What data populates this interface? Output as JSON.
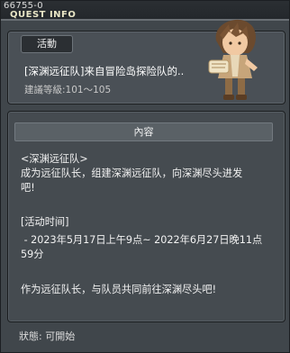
{
  "window": {
    "id": "66755-0",
    "title": "QUEST INFO"
  },
  "quest": {
    "badge": "活動",
    "name": "[深渊远征队]来自冒险岛探险队的..",
    "level": "建議等級:101～105"
  },
  "content": {
    "header": "內容",
    "lines": [
      "<深渊远征队>",
      "成为远征队长，组建深渊远征队，向深渊尽头进发",
      "吧!",
      "",
      "[活动时间]",
      " - 2023年5月17日上午9点~ 2022年6月27日晚11点",
      "59分",
      "",
      "作为远征队长，与队员共同前往深渊尽头吧!"
    ]
  },
  "status": {
    "text": "狀態: 可開始"
  }
}
